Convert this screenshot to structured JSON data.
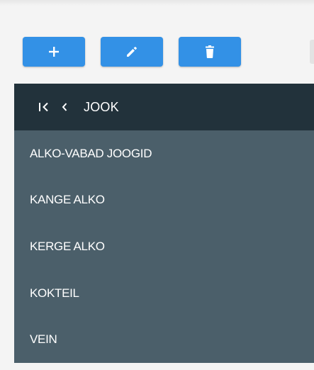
{
  "toolbar": {
    "buttons": [
      {
        "name": "add-button",
        "icon": "plus-icon"
      },
      {
        "name": "edit-button",
        "icon": "pencil-icon"
      },
      {
        "name": "delete-button",
        "icon": "trash-icon"
      }
    ]
  },
  "list": {
    "header": {
      "title": "JOOK",
      "first_icon": "first-page-icon",
      "back_icon": "chevron-left-icon"
    },
    "items": [
      {
        "label": "ALKO-VABAD JOOGID"
      },
      {
        "label": "KANGE ALKO"
      },
      {
        "label": "KERGE ALKO"
      },
      {
        "label": "KOKTEIL"
      },
      {
        "label": "VEIN"
      }
    ]
  },
  "colors": {
    "accent": "#3391e6",
    "header_bg": "#22323b",
    "list_bg": "#4b5f6a",
    "panel_bg": "#f4f4f4"
  }
}
